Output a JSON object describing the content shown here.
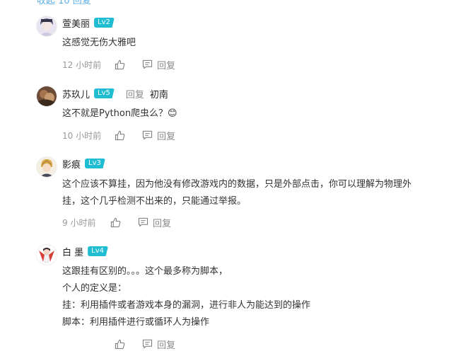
{
  "top_link": "收起 10 回复",
  "comments": [
    {
      "username": "萱美丽",
      "level": "Lv2",
      "text": "这感觉无伤大雅吧",
      "time": "12 小时前",
      "reply_label": "回复"
    },
    {
      "username": "苏玖儿",
      "level": "Lv5",
      "reply_word": "回复",
      "reply_to": "初南",
      "text": "这不就是Python爬虫么？😊",
      "time": "10 小时前",
      "reply_label": "回复"
    },
    {
      "username": "影痕",
      "level": "Lv3",
      "text_lines": [
        "这个应该不算挂，因为他没有修改游戏内的数据，只是外部点击，你可以理解为物理外",
        "挂，这个几乎检测不出来的，只能通过举报。"
      ],
      "time": "9 小时前",
      "reply_label": "回复"
    },
    {
      "username": "白 墨",
      "level": "Lv4",
      "text_lines": [
        "这跟挂有区别的。。。这个最多称为脚本，",
        "个人的定义是：",
        "挂：利用插件或者游戏本身的漏洞，进行非人为能达到的操作",
        "脚本：利用插件进行或循环人为操作"
      ],
      "time": "",
      "reply_label": "回复"
    }
  ],
  "colors": {
    "level_badge": "#1fbcd2",
    "link": "#5fb0e6",
    "meta": "#999999"
  }
}
